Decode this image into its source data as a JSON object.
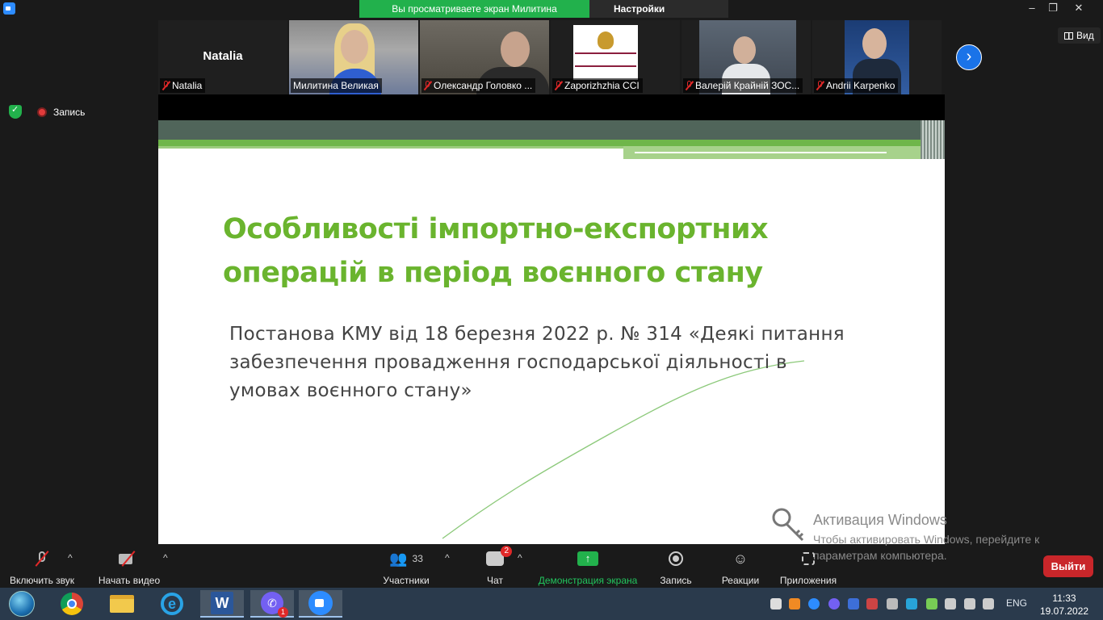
{
  "banner": {
    "share_text": "Вы просматриваете экран Милитина Великая",
    "view_settings": "Настройки просмотра"
  },
  "participants": [
    {
      "name": "Natalia",
      "big_name": "Natalia",
      "muted": true
    },
    {
      "name": "Милитина Великая",
      "muted": false,
      "active": true
    },
    {
      "name": "Олександр Головко ...",
      "muted": true
    },
    {
      "name": "Zaporizhzhia CCI",
      "muted": true
    },
    {
      "name": "Валерій Крайній ЗОС...",
      "muted": true
    },
    {
      "name": "Andrii Karpenko",
      "muted": true
    }
  ],
  "view_button": "Вид",
  "recording_label": "Запись",
  "slide": {
    "title": "Особливості імпортно-експортних операцій в період воєнного стану",
    "subtitle": "Постанова КМУ від 18 березня 2022 р. № 314 «Деякі питання забезпечення провадження господарської діяльності в умовах воєнного стану»",
    "accent_color": "#6ab42e"
  },
  "watermark": {
    "title": "Активация Windows",
    "text": "Чтобы активировать Windows, перейдите к параметрам компьютера."
  },
  "toolbar": {
    "mute_label": "Включить звук",
    "video_label": "Начать видео",
    "participants_label": "Участники",
    "participants_count": "33",
    "chat_label": "Чат",
    "chat_badge": "2",
    "share_label": "Демонстрация экрана",
    "record_label": "Запись",
    "reactions_label": "Реакции",
    "apps_label": "Приложения",
    "leave_label": "Выйти"
  },
  "taskbar": {
    "apps": [
      "start-orb",
      "chrome",
      "file-explorer",
      "internet-explorer",
      "word",
      "viber",
      "zoom"
    ],
    "viber_badge": "1",
    "lang": "ENG",
    "time": "11:33",
    "date": "19.07.2022"
  }
}
